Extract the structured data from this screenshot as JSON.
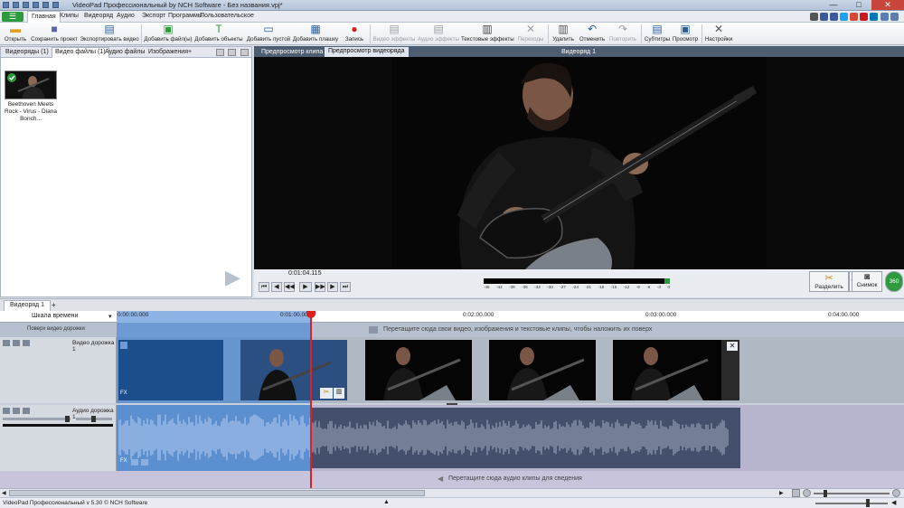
{
  "window": {
    "title": "VideoPad Профессиональный by NCH Software - Без названия.vpj*",
    "minimize": "—",
    "maximize": "□",
    "close": "✕"
  },
  "menu": {
    "hamburger": "☰",
    "tabs": [
      "Главная",
      "Клипы",
      "Видеоряд",
      "Аудио",
      "Экспорт",
      "Программы",
      "Пользовательское"
    ]
  },
  "toolbar": {
    "items": [
      {
        "label": "Открыть",
        "icon": "folder-icon"
      },
      {
        "label": "Сохранить проект",
        "icon": "save-icon"
      },
      {
        "label": "Экспортировать видео",
        "icon": "export-icon"
      },
      {
        "label": "Добавить файл(ы)",
        "icon": "add-file-icon"
      },
      {
        "label": "Добавить объекты",
        "icon": "add-objects-icon"
      },
      {
        "label": "Добавить пустой",
        "icon": "add-blank-icon"
      },
      {
        "label": "Добавить плашку",
        "icon": "add-title-icon"
      },
      {
        "label": "Запись",
        "icon": "record-icon"
      },
      {
        "label": "Видео эффекты",
        "icon": "video-effects-icon"
      },
      {
        "label": "Аудио эффекты",
        "icon": "audio-effects-icon"
      },
      {
        "label": "Текстовые эффекты",
        "icon": "text-effects-icon"
      },
      {
        "label": "Переходы",
        "icon": "transitions-icon"
      },
      {
        "label": "Удалить",
        "icon": "trash-icon"
      },
      {
        "label": "Отменить",
        "icon": "undo-icon"
      },
      {
        "label": "Повторить",
        "icon": "redo-icon"
      },
      {
        "label": "Субтитры",
        "icon": "subtitles-icon"
      },
      {
        "label": "Просмотр",
        "icon": "preview-icon"
      },
      {
        "label": "Настройки",
        "icon": "settings-icon"
      }
    ]
  },
  "bin": {
    "tabs": [
      "Видеоряды (1)",
      "Видео файлы (1)",
      "Аудио файлы",
      "Изображения",
      "+"
    ],
    "active_tab": 1,
    "file": {
      "caption": "Beethoven Meets Rock - Virus - Diana Bonch..."
    }
  },
  "preview": {
    "tabs": [
      "Предпросмотр клипа",
      "Предпросмотр видеоряда"
    ],
    "active_tab": 1,
    "sequence_label": "Видеоряд 1",
    "timecode": "0:01:04.115",
    "meter_labels": [
      "-45",
      "-42",
      "-39",
      "-36",
      "-33",
      "-30",
      "-27",
      "-24",
      "-21",
      "-18",
      "-15",
      "-12",
      "-9",
      "-6",
      "-3",
      "0"
    ],
    "split_label": "Разделить",
    "snapshot_label": "Снимок",
    "vr_label": "360"
  },
  "timeline": {
    "sequence_tab": "Видеоряд 1",
    "add_tab": "+",
    "scale_label": "Шкала времени",
    "ruler_marks": [
      "0:00:00.000",
      "0:01:00.000",
      "0:02:00.000",
      "0:03:00.000",
      "0:04:00.000"
    ],
    "overlay_label": "Поверх видео дорожки",
    "overlay_hint": "Перетащите сюда свои видео, изображения и текстовые клипы, чтобы наложить их поверх",
    "video_track_label": "Видео дорожка 1",
    "audio_track_label": "Аудио дорожка 1",
    "audio_hint": "Перетащите сюда аудио клипы для сведения",
    "fx_label": "FX"
  },
  "status": {
    "text": "VideoPad Профессиональный v 5.30 © NCH Software"
  },
  "colors": {
    "accent": "#2d9a3c",
    "playhead": "#e02020",
    "selection": "#5b8fd0"
  }
}
